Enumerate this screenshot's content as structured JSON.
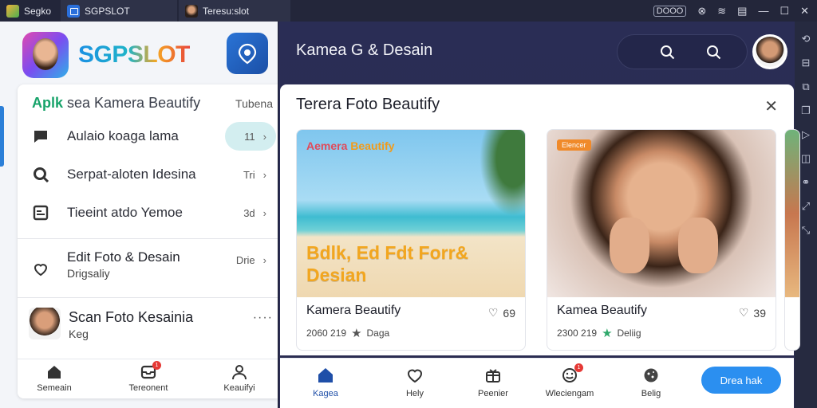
{
  "tabs": [
    {
      "label": "Segko"
    },
    {
      "label": "SGPSLOT"
    },
    {
      "label": "Teresu:slot"
    }
  ],
  "system": {
    "label": "DOOO"
  },
  "brand": {
    "name": "SGPSLOT"
  },
  "left": {
    "header_green": "Aplk",
    "header_rest": " sea Kamera Beautify",
    "header_right": "Tubena",
    "menu": [
      {
        "label": "Aulaio koaga lama",
        "meta": "11",
        "icon": "chat-icon"
      },
      {
        "label": "Serpat-aloten Idesina",
        "meta": "Tri",
        "icon": "search-icon"
      },
      {
        "label": "Tieeint atdo Yemoe",
        "meta": "3d",
        "icon": "gallery-icon"
      }
    ],
    "edit": {
      "title": "Edit Foto & Desain",
      "sub": "Drigsaliy",
      "meta": "Drie"
    },
    "profile": {
      "title": "Scan Foto Kesainia",
      "sub": "Keg",
      "more": "····"
    },
    "bottom_nav": [
      {
        "label": "Semeain",
        "icon": "home-icon"
      },
      {
        "label": "Tereonent",
        "icon": "inbox-icon",
        "badge": "1"
      },
      {
        "label": "Keauifyi",
        "icon": "person-icon"
      }
    ]
  },
  "main": {
    "title": "Kamea G & Desain",
    "dialog": {
      "title": "Terera Foto Beautify",
      "cards": [
        {
          "overlay_top_a": "Aemera ",
          "overlay_top_b": "Beautify",
          "overlay_big": "Bdlk, Ed Fdt Forr& Desian",
          "name": "Kamera Beautify",
          "likes": "69",
          "meta": "2060 219",
          "meta_b": "Daga"
        },
        {
          "tag": "Elencer",
          "name": "Kamea Beautify",
          "likes": "39",
          "meta": "2300 219",
          "meta_b": "Deliig"
        }
      ]
    },
    "bottom_nav": [
      {
        "label": "Kagea",
        "icon": "home-icon",
        "active": true
      },
      {
        "label": "Hely",
        "icon": "heart-icon"
      },
      {
        "label": "Peenier",
        "icon": "gift-icon"
      },
      {
        "label": "Wleciengam",
        "icon": "emoji-icon",
        "badge": "1"
      },
      {
        "label": "Belig",
        "icon": "cookie-icon"
      }
    ],
    "cta": "Drea hak"
  },
  "colors": {
    "accent": "#2b8ff0",
    "sidebar_dark": "#2a2d55",
    "brand_green": "#17a36a"
  }
}
